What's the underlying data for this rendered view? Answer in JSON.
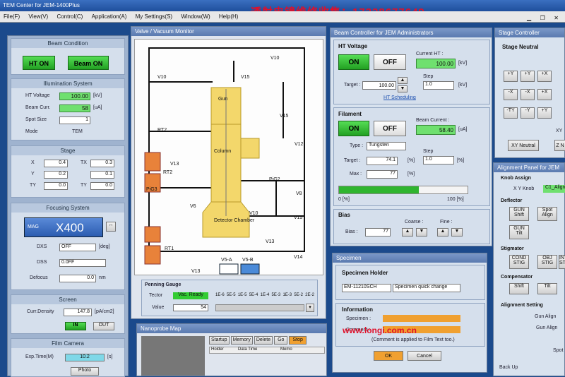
{
  "app": {
    "title": "TEM Center for JEM-1400Plus",
    "watermark": "透射电镜维修收售：17328677649",
    "watermark2": "www.longi.com.cn"
  },
  "menu": [
    "File(F)",
    "View(V)",
    "Control(C)",
    "Application(A)",
    "My Settings(S)",
    "Window(W)",
    "Help(H)"
  ],
  "left": {
    "beam_condition": {
      "title": "Beam Condition",
      "ht_on": "HT ON",
      "beam_on": "Beam ON"
    },
    "illum": {
      "title": "Illumination System",
      "ht_label": "HT Voltage",
      "ht_value": "100.00",
      "ht_unit": "[kV]",
      "beam_label": "Beam Curr.",
      "beam_value": "58",
      "beam_unit": "[uA]",
      "spot_label": "Spot Size",
      "spot_value": "1",
      "mode_label": "Mode",
      "mode_value": "TEM"
    },
    "stage": {
      "title": "Stage",
      "x_label": "X",
      "x_value": "0.4",
      "tx_label": "TX",
      "tx_value": "0.3",
      "y_label": "Y",
      "y_value": "0.2",
      "ty2": "0.1",
      "z_label": "TY",
      "z_value": "0.0",
      "ty_label": "TY",
      "ty_value": "0.0"
    },
    "focus": {
      "title": "Focusing System",
      "mode": "MAG",
      "mag": "X400",
      "dx_label": "DXS",
      "dx_value": "OFF",
      "dx_unit": "[deg]",
      "dss_label": "DSS",
      "dss_value": "0.0FF",
      "defocus_label": "Defocus",
      "defocus_value": "0.0",
      "defocus_unit": "nm"
    },
    "screen": {
      "title": "Screen",
      "density_label": "Curr.Density",
      "density_value": "147.8",
      "density_unit": "[pA/cm2]",
      "in": "IN",
      "out": "OUT"
    },
    "camera": {
      "title": "Film Camera",
      "exp_label": "Exp.Time(M)",
      "exp_value": "10.2",
      "exp_unit": "[s]",
      "photo": "Photo"
    }
  },
  "valve": {
    "title": "Valve / Vacuum Monitor",
    "labels": [
      "V10",
      "V15",
      "V15",
      "V10",
      "RT2",
      "V13",
      "V12",
      "RT2",
      "V8",
      "V6",
      "V10",
      "V15",
      "V13",
      "V14",
      "V13",
      "RT1",
      "V5-A",
      "V5-B",
      "PiG2",
      "PiG3"
    ],
    "gun": "Gun",
    "column": "Column",
    "detector": "Detector Chamber",
    "penning_title": "Penning Gauge",
    "penning_label": "Tector",
    "penning_state": "Vac. Ready",
    "value_label": "Value",
    "value": "54",
    "scale": [
      "1E-6",
      "5E-5",
      "1E-5",
      "5E-4",
      "1E-4",
      "5E-3",
      "1E-3",
      "5E-2",
      "2E-2"
    ]
  },
  "nanoprobe": {
    "title": "Nanoprobe Map",
    "tabs": [
      "Startup",
      "Memory",
      "Delete",
      "Go",
      "Stop"
    ],
    "cols": [
      "Holder",
      "Data Time",
      "Memo"
    ]
  },
  "beam_ctrl": {
    "title": "Beam Controller for JEM Administrators",
    "ht_title": "HT Voltage",
    "on": "ON",
    "off": "OFF",
    "current_ht_label": "Current HT :",
    "current_ht": "100.00",
    "unit_kv": "[kV]",
    "target_label": "Target :",
    "target": "100.00",
    "step_label": "Step",
    "step": "1.0",
    "scheduling": "HT Scheduling",
    "fil_title": "Filament",
    "fil_on": "ON",
    "fil_off": "OFF",
    "beam_curr_label": "Beam Current :",
    "beam_curr": "58.40",
    "unit_ua": "[uA]",
    "type_label": "Type :",
    "type": "Tungsten",
    "fil_target": "74.1",
    "fil_step": "1.0",
    "max_label": "Max :",
    "max": "77",
    "unit_pct": "[%]",
    "progress": 0.62,
    "prog_min": "0 [%]",
    "prog_max": "100 [%]",
    "bias_title": "Bias",
    "bias_label": "Bias :",
    "bias": "77",
    "coarse": "Coarse :",
    "fine": "Fine :"
  },
  "specimen": {
    "title": "Specimen",
    "holder_title": "Specimen Holder",
    "holder": "EM-11210SCH",
    "change": "Specimen quick change",
    "info_title": "Information",
    "specimen_label": "Specimen :",
    "comment_label": "Comment :",
    "note": "(Comment is applied to Film Text too.)",
    "ok": "OK",
    "cancel": "Cancel"
  },
  "stage_ctrl": {
    "title": "Stage Controller",
    "neutral": "Stage Neutral",
    "buttons": [
      "+Y",
      "+Y",
      "+X",
      "-X",
      "-X",
      "+X",
      "-TY",
      "-Y",
      "+Y"
    ],
    "xy_neutral": "XY Neutral",
    "z_n": "Z N",
    "xy": "XY"
  },
  "align": {
    "title": "Alignment Panel for JEM",
    "knob_title": "Knob Assign",
    "knob_label": "X Y Knob",
    "knob_value": "C1_Align",
    "deflector": "Deflector",
    "d_btns": [
      "GUN Shift",
      "Spot Align",
      "GUN Tilt"
    ],
    "stigmator": "Stigmator",
    "s_btns": [
      "COND STIG",
      "OBJ STIG",
      "INT STIG"
    ],
    "compensator": "Compensator",
    "c_btns": [
      "Shift",
      "Tilt"
    ],
    "setting": "Alignment Setting",
    "a_items": [
      "Gun Align",
      "Gun Align",
      "Spot"
    ],
    "back": "Back Up"
  }
}
